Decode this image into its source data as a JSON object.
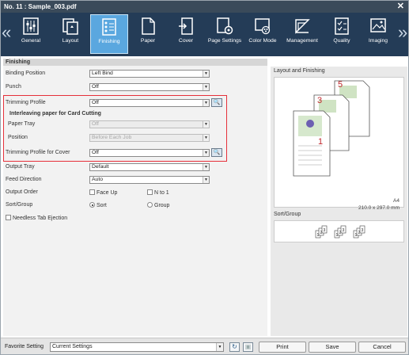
{
  "window": {
    "title": "No. 11 : Sample_003.pdf",
    "close_glyph": "✕"
  },
  "toolbar": {
    "prev_glyph": "«",
    "next_glyph": "»",
    "items": [
      {
        "label": "General",
        "icon": "general-icon"
      },
      {
        "label": "Layout",
        "icon": "layout-icon"
      },
      {
        "label": "Finishing",
        "icon": "finishing-icon",
        "active": true
      },
      {
        "label": "Paper",
        "icon": "paper-icon"
      },
      {
        "label": "Cover",
        "icon": "cover-icon"
      },
      {
        "label": "Page Settings",
        "icon": "page-settings-icon"
      },
      {
        "label": "Color Mode",
        "icon": "color-mode-icon"
      },
      {
        "label": "Management",
        "icon": "management-icon"
      },
      {
        "label": "Quality",
        "icon": "quality-icon"
      },
      {
        "label": "Imaging",
        "icon": "imaging-icon"
      }
    ],
    "active_color": "#5aa7df"
  },
  "finishing": {
    "section_title": "Finishing",
    "binding_position": {
      "label": "Binding Position",
      "value": "Left Bind"
    },
    "punch": {
      "label": "Punch",
      "value": "Off"
    },
    "trimming_profile": {
      "label": "Trimming Profile",
      "value": "Off"
    },
    "interleaving_header": "Interleaving paper for Card Cutting",
    "paper_tray": {
      "label": "Paper Tray",
      "value": "Off"
    },
    "position": {
      "label": "Position",
      "value": "Before Each Job"
    },
    "trimming_profile_cover": {
      "label": "Trimming Profile for Cover",
      "value": "Off"
    },
    "output_tray": {
      "label": "Output Tray",
      "value": "Default"
    },
    "feed_direction": {
      "label": "Feed Direction",
      "value": "Auto"
    },
    "output_order": {
      "label": "Output Order",
      "face_up": "Face Up",
      "n_to_1": "N to 1"
    },
    "sort_group": {
      "label": "Sort/Group",
      "sort": "Sort",
      "group": "Group",
      "selected": "Sort"
    },
    "needless_tab": "Needless Tab Ejection",
    "highlight_color": "#e6303a"
  },
  "preview": {
    "layout_title": "Layout and Finishing",
    "page_numbers": [
      "5",
      "3",
      "1"
    ],
    "size_name": "A4",
    "size_dims": "210.0 x 297.0 mm",
    "sort_title": "Sort/Group",
    "sort_digits": [
      "1",
      "2",
      "3"
    ]
  },
  "bottom": {
    "favorite_label": "Favorite Setting",
    "favorite_value": "Current Settings",
    "print": "Print",
    "save": "Save",
    "cancel": "Cancel"
  }
}
